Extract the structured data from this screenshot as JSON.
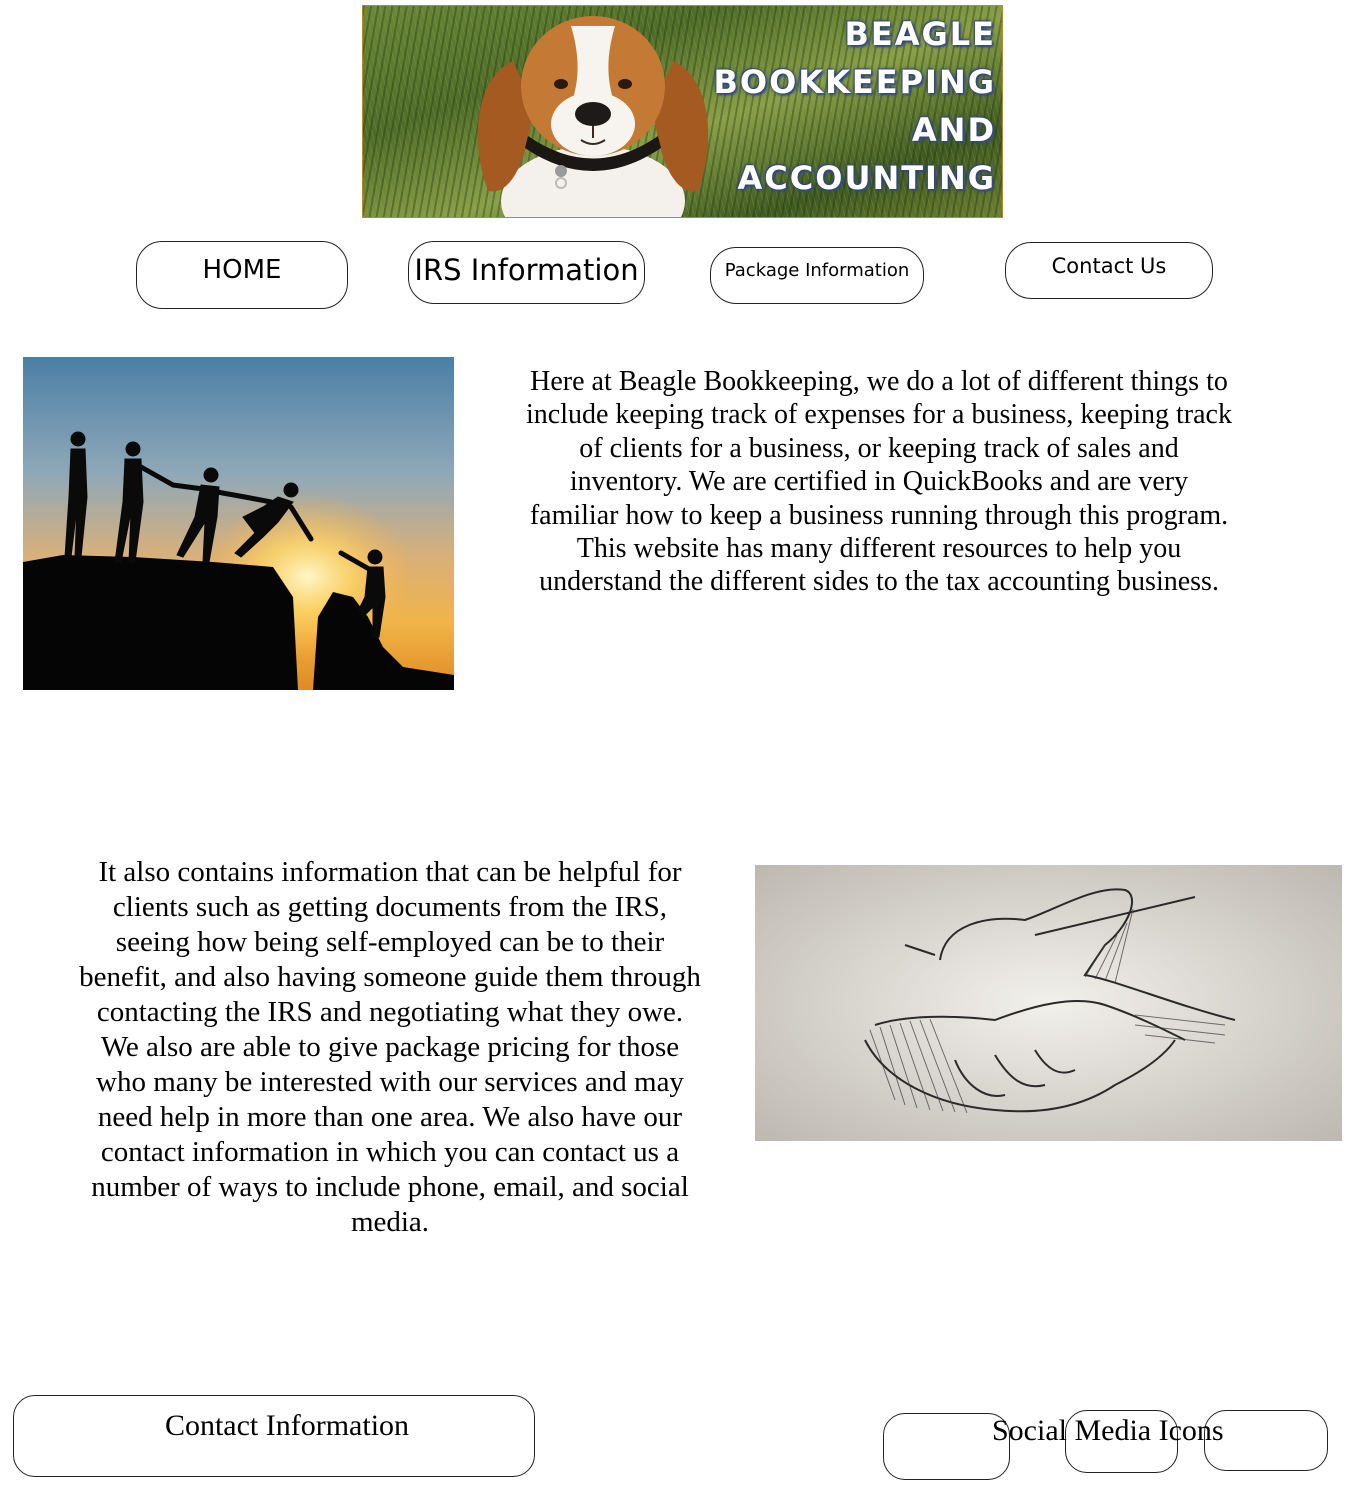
{
  "logo": {
    "lines": [
      "BEAGLE",
      "BOOKKEEPING",
      "AND",
      "ACCOUNTING"
    ]
  },
  "nav": {
    "home": "HOME",
    "irs": "IRS Information",
    "package": "Package Information",
    "contact": "Contact Us"
  },
  "content": {
    "paragraph1": "Here at Beagle Bookkeeping, we do a lot of different things to include keeping track of expenses for a business, keeping track of clients for a business, or keeping track of sales and inventory.  We are certified in QuickBooks and are very familiar how to keep a business running through this program.  This website has many different resources to help you understand the different sides to the tax accounting business.",
    "paragraph2": "It also contains information that can be helpful for clients such as getting documents from the IRS, seeing how being self-employed can be to their benefit, and also having someone guide them through contacting the IRS and negotiating what they owe.  We also are able to give package pricing for those who many be interested with our services and may need help in more than one area.  We also have our contact information in which you can contact us a number of ways to include phone, email, and social media."
  },
  "footer": {
    "contact_info": "Contact Information",
    "social_media": "Social Media Icons"
  },
  "colors": {
    "button_border": "#222222",
    "logo_text": "#ffffff",
    "logo_border": "#b48a2c"
  }
}
